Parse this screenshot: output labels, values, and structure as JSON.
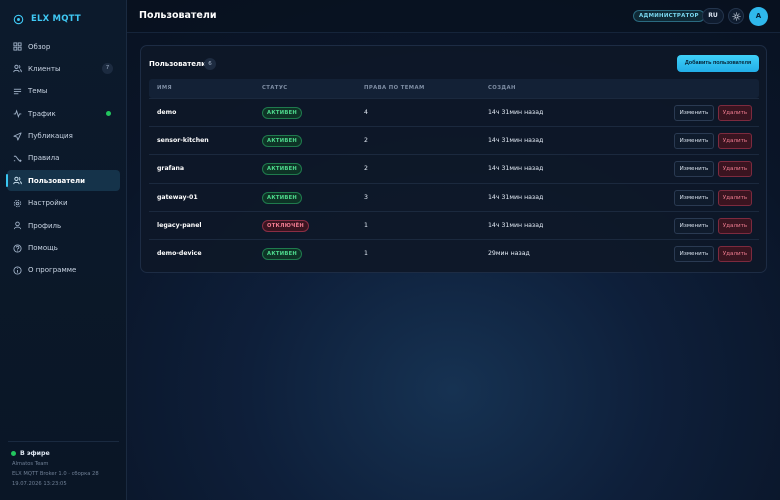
{
  "brand": {
    "name": "ELX MQTT"
  },
  "sidebar": {
    "items": [
      {
        "key": "overview",
        "label": "Обзор",
        "icon": "grid-icon"
      },
      {
        "key": "clients",
        "label": "Клиенты",
        "icon": "users-icon",
        "badge": "7"
      },
      {
        "key": "topics",
        "label": "Темы",
        "icon": "list-icon"
      },
      {
        "key": "traffic",
        "label": "Трафик",
        "icon": "activity-icon"
      },
      {
        "key": "publish",
        "label": "Публикация",
        "icon": "send-icon"
      },
      {
        "key": "rules",
        "label": "Правила",
        "icon": "shuffle-icon"
      },
      {
        "key": "users",
        "label": "Пользователи",
        "icon": "users-icon"
      },
      {
        "key": "settings",
        "label": "Настройки",
        "icon": "gear-icon"
      },
      {
        "key": "profile",
        "label": "Профиль",
        "icon": "user-icon"
      },
      {
        "key": "help",
        "label": "Помощь",
        "icon": "help-icon"
      },
      {
        "key": "about",
        "label": "О программе",
        "icon": "info-icon"
      }
    ],
    "footer": {
      "status": "В эфире",
      "line1": "Almatos Team",
      "line2": "ELX MQTT Broker 1.0 · сборка 28",
      "line3": "19.07.2026 13:23:05"
    }
  },
  "header": {
    "title": "Пользователи",
    "role": "АДМИНИСТРАТОР",
    "lang": "RU",
    "avatar": "A"
  },
  "users_card": {
    "title": "Пользователи",
    "count": "6",
    "add_label": "Добавить пользователя",
    "columns": {
      "name": "ИМЯ",
      "status": "СТАТУС",
      "perms": "ПРАВА ПО ТЕМАМ",
      "created": "СОЗДАН"
    },
    "edit_label": "Изменить",
    "delete_label": "Удалить",
    "rows": [
      {
        "name": "demo",
        "status": "АКТИВЕН",
        "active": true,
        "perms": "4",
        "created": "14ч 31мин назад"
      },
      {
        "name": "sensor-kitchen",
        "status": "АКТИВЕН",
        "active": true,
        "perms": "2",
        "created": "14ч 31мин назад"
      },
      {
        "name": "grafana",
        "status": "АКТИВЕН",
        "active": true,
        "perms": "2",
        "created": "14ч 31мин назад"
      },
      {
        "name": "gateway-01",
        "status": "АКТИВЕН",
        "active": true,
        "perms": "3",
        "created": "14ч 31мин назад"
      },
      {
        "name": "legacy-panel",
        "status": "ОТКЛЮЧЁН",
        "active": false,
        "perms": "1",
        "created": "14ч 31мин назад"
      },
      {
        "name": "demo-device",
        "status": "АКТИВЕН",
        "active": true,
        "perms": "1",
        "created": "29мин назад"
      }
    ]
  },
  "colors": {
    "accent": "#39c6f2",
    "active_green": "#22c55e",
    "danger": "#f27d92"
  }
}
